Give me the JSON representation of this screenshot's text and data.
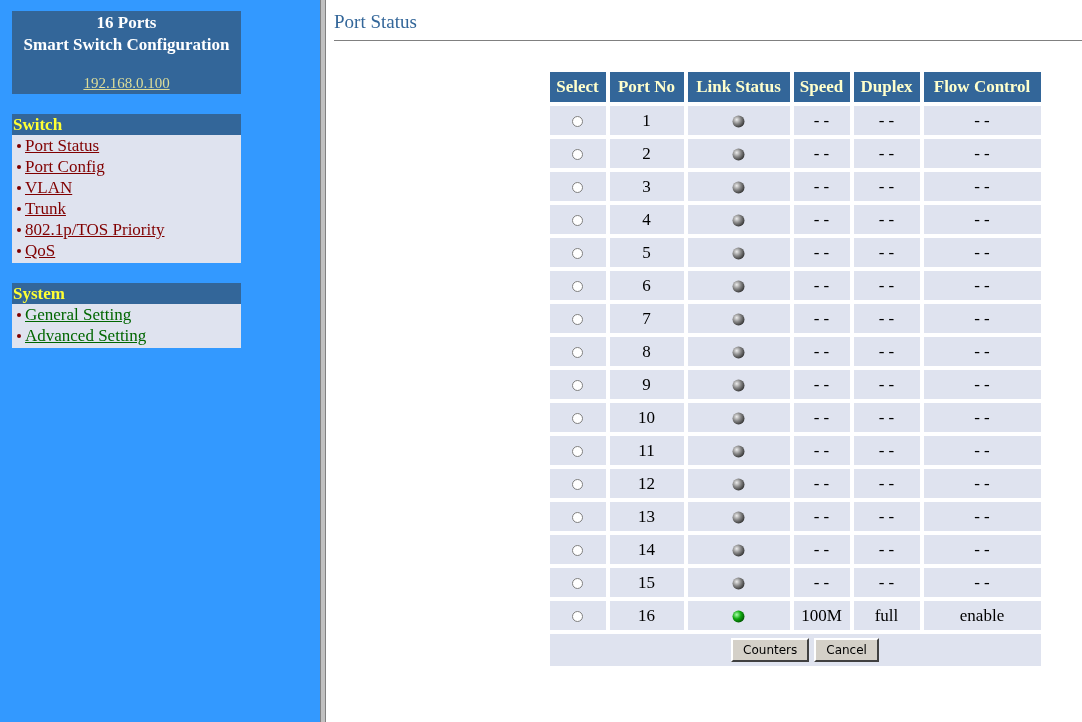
{
  "sidebar": {
    "title_lines": [
      "16 Ports",
      "Smart Switch Configuration"
    ],
    "address": "192.168.0.100",
    "sections": [
      {
        "kind": "switch",
        "heading": "Switch",
        "items": [
          "Port Status",
          "Port Config",
          "VLAN",
          "Trunk",
          "802.1p/TOS Priority",
          "QoS"
        ]
      },
      {
        "kind": "system",
        "heading": "System",
        "items": [
          "General Setting",
          "Advanced Setting"
        ]
      }
    ]
  },
  "page_title": "Port Status",
  "table": {
    "columns": [
      "Select",
      "Port No",
      "Link Status",
      "Speed",
      "Duplex",
      "Flow Control"
    ],
    "rows": [
      {
        "selected": false,
        "port": "1",
        "link_up": false,
        "speed": "- -",
        "duplex": "- -",
        "flow_control": "- -"
      },
      {
        "selected": false,
        "port": "2",
        "link_up": false,
        "speed": "- -",
        "duplex": "- -",
        "flow_control": "- -"
      },
      {
        "selected": false,
        "port": "3",
        "link_up": false,
        "speed": "- -",
        "duplex": "- -",
        "flow_control": "- -"
      },
      {
        "selected": false,
        "port": "4",
        "link_up": false,
        "speed": "- -",
        "duplex": "- -",
        "flow_control": "- -"
      },
      {
        "selected": false,
        "port": "5",
        "link_up": false,
        "speed": "- -",
        "duplex": "- -",
        "flow_control": "- -"
      },
      {
        "selected": false,
        "port": "6",
        "link_up": false,
        "speed": "- -",
        "duplex": "- -",
        "flow_control": "- -"
      },
      {
        "selected": false,
        "port": "7",
        "link_up": false,
        "speed": "- -",
        "duplex": "- -",
        "flow_control": "- -"
      },
      {
        "selected": false,
        "port": "8",
        "link_up": false,
        "speed": "- -",
        "duplex": "- -",
        "flow_control": "- -"
      },
      {
        "selected": false,
        "port": "9",
        "link_up": false,
        "speed": "- -",
        "duplex": "- -",
        "flow_control": "- -"
      },
      {
        "selected": false,
        "port": "10",
        "link_up": false,
        "speed": "- -",
        "duplex": "- -",
        "flow_control": "- -"
      },
      {
        "selected": false,
        "port": "11",
        "link_up": false,
        "speed": "- -",
        "duplex": "- -",
        "flow_control": "- -"
      },
      {
        "selected": false,
        "port": "12",
        "link_up": false,
        "speed": "- -",
        "duplex": "- -",
        "flow_control": "- -"
      },
      {
        "selected": false,
        "port": "13",
        "link_up": false,
        "speed": "- -",
        "duplex": "- -",
        "flow_control": "- -"
      },
      {
        "selected": false,
        "port": "14",
        "link_up": false,
        "speed": "- -",
        "duplex": "- -",
        "flow_control": "- -"
      },
      {
        "selected": false,
        "port": "15",
        "link_up": false,
        "speed": "- -",
        "duplex": "- -",
        "flow_control": "- -"
      },
      {
        "selected": false,
        "port": "16",
        "link_up": true,
        "speed": "100M",
        "duplex": "full",
        "flow_control": "enable"
      }
    ],
    "buttons": [
      "Counters",
      "Cancel"
    ]
  }
}
